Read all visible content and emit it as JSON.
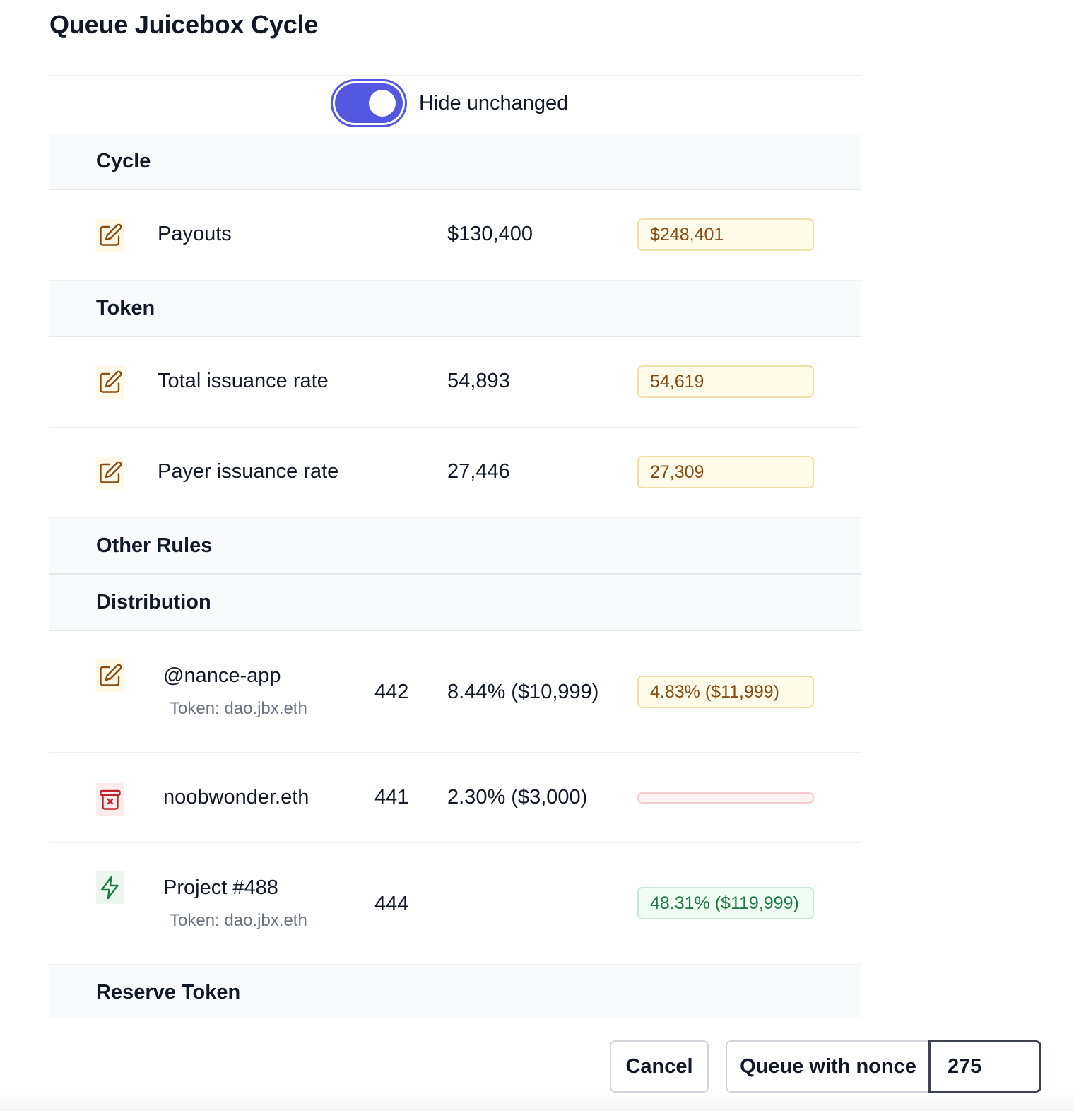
{
  "modal": {
    "title": "Queue Juicebox Cycle"
  },
  "toggle": {
    "label": "Hide unchanged",
    "checked": true
  },
  "sections": {
    "cycle": "Cycle",
    "token": "Token",
    "other_rules": "Other Rules",
    "distribution": "Distribution",
    "reserve_token": "Reserve Token"
  },
  "rows": {
    "payouts": {
      "icon": "edit-icon",
      "label": "Payouts",
      "old": "$130,400",
      "new": "$248,401"
    },
    "total_issuance": {
      "icon": "edit-icon",
      "label": "Total issuance rate",
      "old": "54,893",
      "new": "54,619"
    },
    "payer_issuance": {
      "icon": "edit-icon",
      "label": "Payer issuance rate",
      "old": "27,446",
      "new": "27,309"
    }
  },
  "distribution": {
    "nance": {
      "icon": "edit-icon",
      "label": "@nance-app",
      "token": "Token: dao.jbx.eth",
      "id": "442",
      "old": "8.44% ($10,999)",
      "new": "4.83% ($11,999)"
    },
    "noob": {
      "icon": "archive-x-icon",
      "label": "noobwonder.eth",
      "id": "441",
      "old": "2.30% ($3,000)",
      "new": ""
    },
    "project": {
      "icon": "bolt-icon",
      "label": "Project #488",
      "token": "Token: dao.jbx.eth",
      "id": "444",
      "old": "",
      "new": "48.31% ($119,999)"
    }
  },
  "footer": {
    "cancel_label": "Cancel",
    "queue_label": "Queue with nonce",
    "nonce_value": "275"
  },
  "colors": {
    "accent": "#5457e0",
    "changed_text": "#8a4b12",
    "changed_bg": "#fefce8",
    "removed_bg": "#fef2f2",
    "added_text": "#1f7a44",
    "added_bg": "#f0fdf4"
  }
}
